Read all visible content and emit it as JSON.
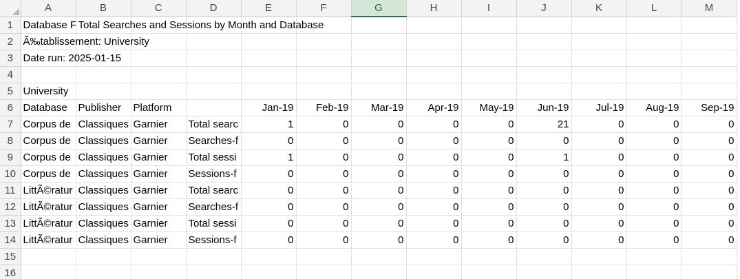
{
  "columns": [
    "A",
    "B",
    "C",
    "D",
    "E",
    "F",
    "G",
    "H",
    "I",
    "J",
    "K",
    "L",
    "M"
  ],
  "selected_column": "G",
  "rows": [
    {
      "n": "1",
      "a": "Database F",
      "b": "Total Searches and Sessions by Month and Database",
      "b_spill": true
    },
    {
      "n": "2",
      "a": "Ã‰tablissement: University",
      "a_spill": true
    },
    {
      "n": "3",
      "a": "Date run: 2025-01-15",
      "a_spill": true
    },
    {
      "n": "4"
    },
    {
      "n": "5",
      "a": "University",
      "a_spill": true
    },
    {
      "n": "6",
      "a": "Database",
      "b": "Publisher",
      "c": "Platform",
      "d": "",
      "months": [
        "Jan-19",
        "Feb-19",
        "Mar-19",
        "Apr-19",
        "May-19",
        "Jun-19",
        "Jul-19",
        "Aug-19",
        "Sep-19"
      ]
    },
    {
      "n": "7",
      "a": "Corpus de",
      "b": "Classiques",
      "c": "Garnier",
      "d": "Total searc",
      "vals": [
        "1",
        "0",
        "0",
        "0",
        "0",
        "21",
        "0",
        "0",
        "0"
      ]
    },
    {
      "n": "8",
      "a": "Corpus de",
      "b": "Classiques",
      "c": "Garnier",
      "d": "Searches-f",
      "vals": [
        "0",
        "0",
        "0",
        "0",
        "0",
        "0",
        "0",
        "0",
        "0"
      ]
    },
    {
      "n": "9",
      "a": "Corpus de",
      "b": "Classiques",
      "c": "Garnier",
      "d": "Total sessi",
      "vals": [
        "1",
        "0",
        "0",
        "0",
        "0",
        "1",
        "0",
        "0",
        "0"
      ]
    },
    {
      "n": "10",
      "a": "Corpus de",
      "b": "Classiques",
      "c": "Garnier",
      "d": "Sessions-f",
      "vals": [
        "0",
        "0",
        "0",
        "0",
        "0",
        "0",
        "0",
        "0",
        "0"
      ]
    },
    {
      "n": "11",
      "a": "LittÃ©ratur",
      "b": "Classiques",
      "c": "Garnier",
      "d": "Total searc",
      "vals": [
        "0",
        "0",
        "0",
        "0",
        "0",
        "0",
        "0",
        "0",
        "0"
      ]
    },
    {
      "n": "12",
      "a": "LittÃ©ratur",
      "b": "Classiques",
      "c": "Garnier",
      "d": "Searches-f",
      "vals": [
        "0",
        "0",
        "0",
        "0",
        "0",
        "0",
        "0",
        "0",
        "0"
      ]
    },
    {
      "n": "13",
      "a": "LittÃ©ratur",
      "b": "Classiques",
      "c": "Garnier",
      "d": "Total sessi",
      "vals": [
        "0",
        "0",
        "0",
        "0",
        "0",
        "0",
        "0",
        "0",
        "0"
      ]
    },
    {
      "n": "14",
      "a": "LittÃ©ratur",
      "b": "Classiques",
      "c": "Garnier",
      "d": "Sessions-f",
      "vals": [
        "0",
        "0",
        "0",
        "0",
        "0",
        "0",
        "0",
        "0",
        "0"
      ]
    },
    {
      "n": "15"
    },
    {
      "n": "16"
    }
  ]
}
